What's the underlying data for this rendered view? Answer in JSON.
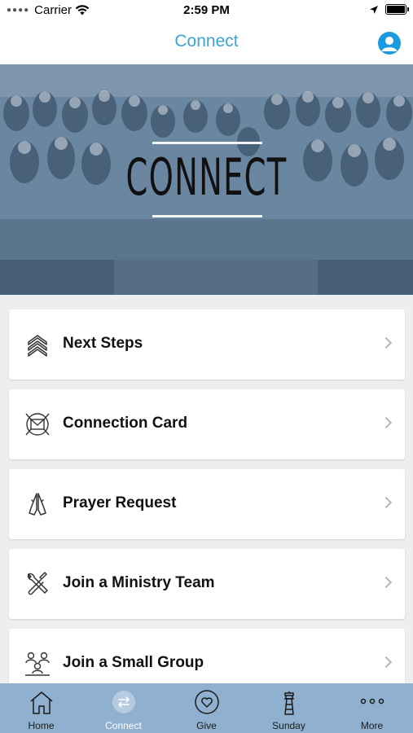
{
  "status_bar": {
    "carrier": "Carrier",
    "time": "2:59 PM"
  },
  "nav": {
    "title": "Connect"
  },
  "hero": {
    "title": "CONNECT"
  },
  "menu": {
    "items": [
      {
        "label": "Next Steps",
        "icon": "chevrons-up-icon"
      },
      {
        "label": "Connection Card",
        "icon": "envelope-icon"
      },
      {
        "label": "Prayer Request",
        "icon": "praying-hands-icon"
      },
      {
        "label": "Join a Ministry Team",
        "icon": "wrench-icon"
      },
      {
        "label": "Join a Small Group",
        "icon": "group-icon"
      }
    ]
  },
  "tabs": [
    {
      "label": "Home",
      "icon": "home-icon",
      "active": false
    },
    {
      "label": "Connect",
      "icon": "connect-arrows-icon",
      "active": true
    },
    {
      "label": "Give",
      "icon": "heart-icon",
      "active": false
    },
    {
      "label": "Sunday",
      "icon": "lighthouse-icon",
      "active": false
    },
    {
      "label": "More",
      "icon": "ellipsis-icon",
      "active": false
    }
  ],
  "colors": {
    "accent": "#3ba4d6",
    "profile": "#1b9ae0",
    "tab_bar": "#8fb0cf",
    "hero_tint": "#5f7c98"
  }
}
